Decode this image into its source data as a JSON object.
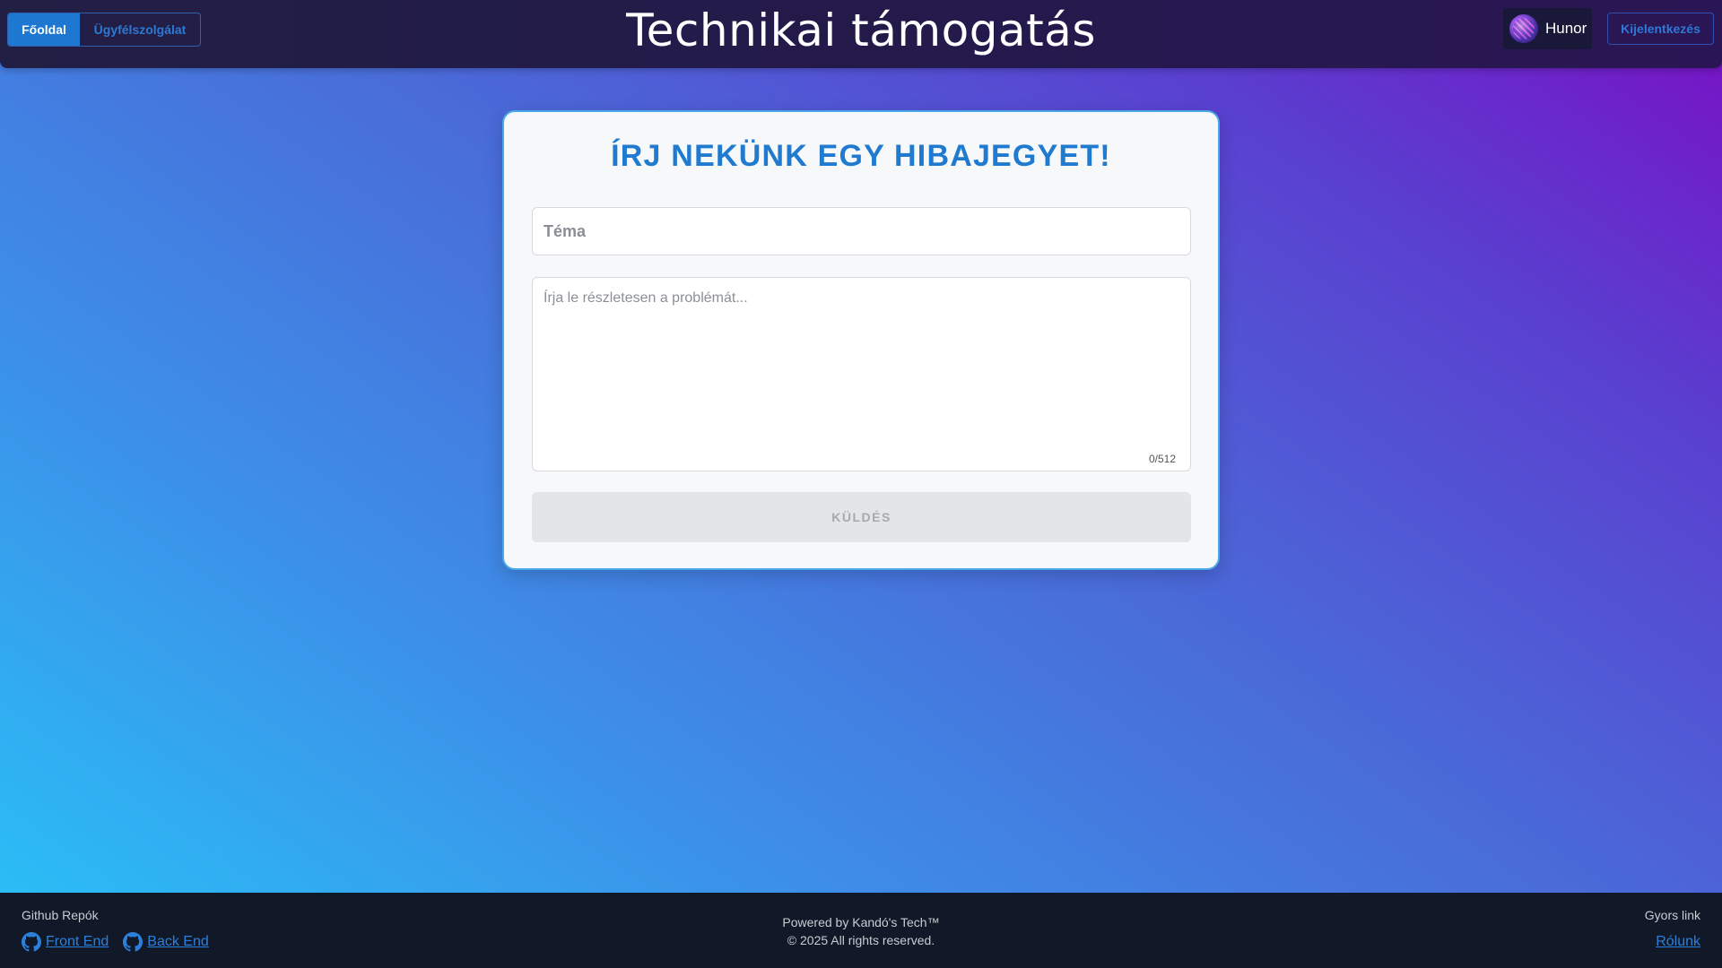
{
  "header": {
    "nav": {
      "home_label": "Főoldal",
      "support_label": "Ügyfélszolgálat"
    },
    "title": "Technikai támogatás",
    "user": {
      "name": "Hunor",
      "avatar_icon": "avatar-image"
    },
    "logout_label": "Kijelentkezés"
  },
  "form": {
    "title": "ÍRJ NEKÜNK EGY HIBAJEGYET!",
    "subject_placeholder": "Téma",
    "subject_value": "",
    "description_placeholder": "Írja le részletesen a problémát...",
    "description_value": "",
    "char_counter": "0/512",
    "submit_label": "KÜLDÉS"
  },
  "footer": {
    "repos_title": "Github Repók",
    "links": [
      {
        "label": "Front End",
        "icon": "github-icon"
      },
      {
        "label": "Back End",
        "icon": "github-icon"
      }
    ],
    "powered_by": "Powered by Kandó's Tech™",
    "copyright": "© 2025 All rights reserved.",
    "quick_link_title": "Gyors link",
    "about_label": "Rólunk"
  },
  "colors": {
    "accent": "#1e78d2",
    "title_blue": "#1f7ad0",
    "header_bg": "#221f45",
    "footer_bg": "#111827",
    "gradient_top_right": "#7a0fc4",
    "gradient_bottom_left": "#28c3f7"
  }
}
